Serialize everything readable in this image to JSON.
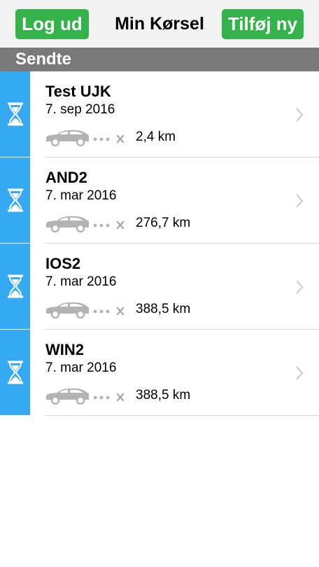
{
  "header": {
    "logout_label": "Log ud",
    "title": "Min Kørsel",
    "add_label": "Tilføj ny"
  },
  "section": {
    "label": "Sendte"
  },
  "trips": [
    {
      "name": "Test UJK",
      "date": "7. sep 2016",
      "distance": "2,4 km"
    },
    {
      "name": "AND2",
      "date": "7. mar 2016",
      "distance": "276,7 km"
    },
    {
      "name": "IOS2",
      "date": "7. mar 2016",
      "distance": "388,5 km"
    },
    {
      "name": "WIN2",
      "date": "7. mar 2016",
      "distance": "388,5 km"
    }
  ],
  "icons": {
    "status": "hourglass-icon",
    "vehicle": "car-icon",
    "chevron": "chevron-right-icon"
  },
  "colors": {
    "button_green": "#33b34a",
    "status_blue": "#36a9f3",
    "section_gray": "#7a7a7a"
  }
}
